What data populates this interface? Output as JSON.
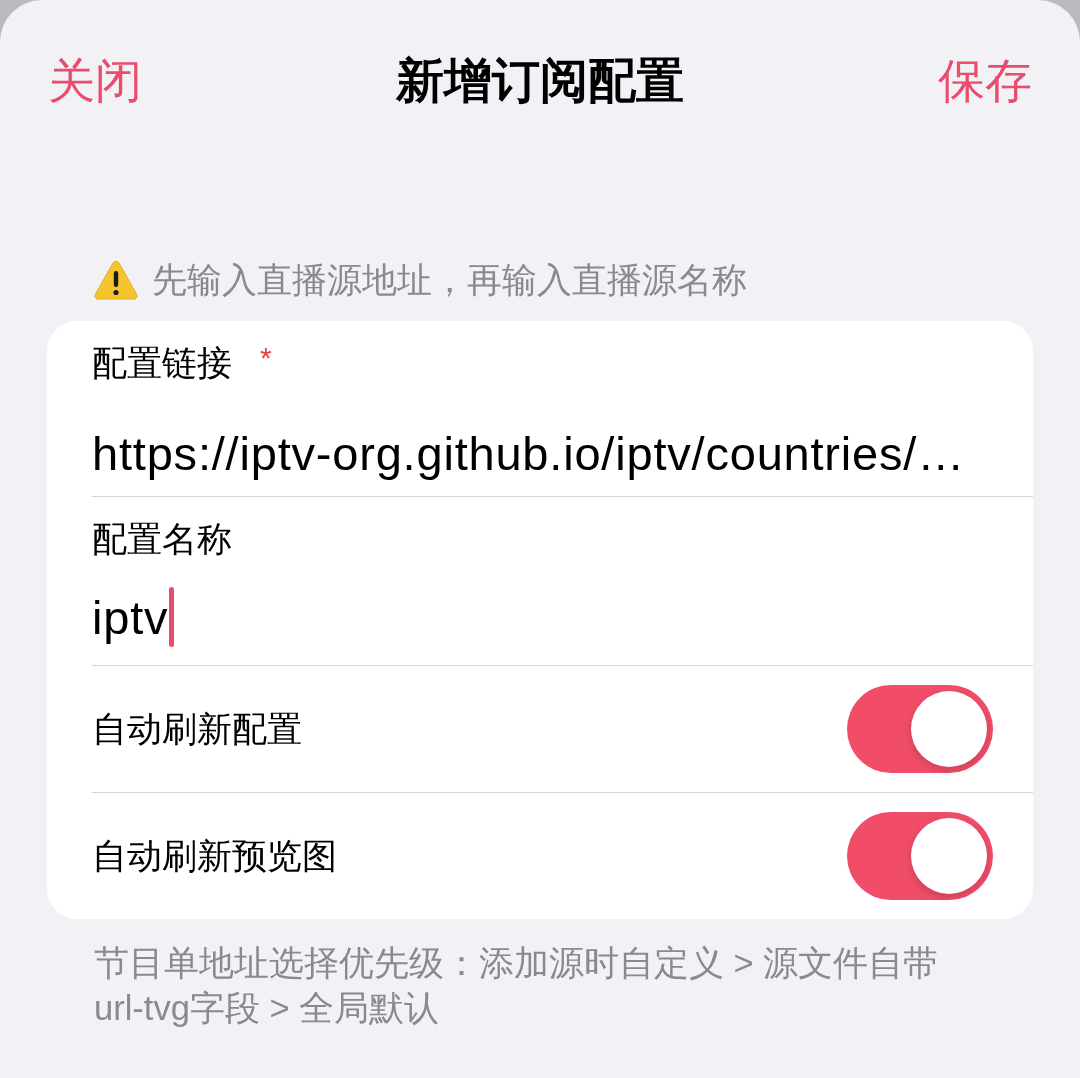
{
  "header": {
    "close": "关闭",
    "title": "新增订阅配置",
    "save": "保存"
  },
  "notice": {
    "text": "先输入直播源地址，再输入直播源名称"
  },
  "fields": [
    {
      "label": "配置链接",
      "required_mark": "*",
      "value": "https://iptv-org.github.io/iptv/countries/…",
      "focused": false
    },
    {
      "label": "配置名称",
      "value": "iptv",
      "focused": true
    }
  ],
  "toggles": [
    {
      "label": "自动刷新配置",
      "on": true
    },
    {
      "label": "自动刷新预览图",
      "on": true
    }
  ],
  "footer": {
    "text": "节目单地址选择优先级：添加源时自定义 > 源文件自带url-tvg字段 > 全局默认"
  }
}
